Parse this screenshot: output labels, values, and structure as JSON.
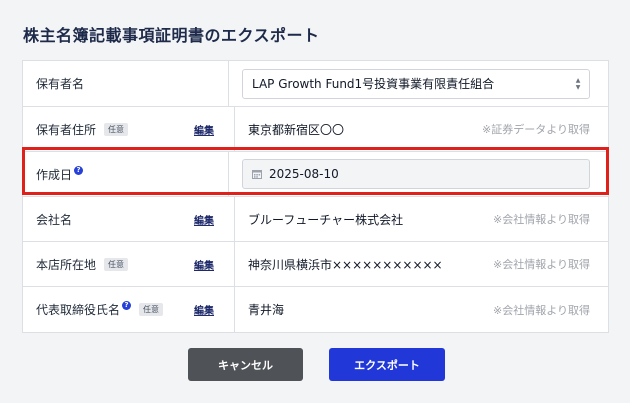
{
  "page": {
    "title": "株主名簿記載事項証明書のエクスポート"
  },
  "form": {
    "holder_name": {
      "label": "保有者名",
      "value": "LAP Growth Fund1号投資事業有限責任組合"
    },
    "holder_address": {
      "label": "保有者住所",
      "badge": "任意",
      "edit": "編集",
      "value": "東京都新宿区〇〇",
      "note": "※証券データより取得"
    },
    "created_date": {
      "label": "作成日",
      "value": "2025-08-10"
    },
    "company_name": {
      "label": "会社名",
      "edit": "編集",
      "value": "ブルーフューチャー株式会社",
      "note": "※会社情報より取得"
    },
    "head_office": {
      "label": "本店所在地",
      "badge": "任意",
      "edit": "編集",
      "value": "神奈川県横浜市×××××××××××",
      "note": "※会社情報より取得"
    },
    "representative": {
      "label": "代表取締役氏名",
      "badge": "任意",
      "edit": "編集",
      "value": "青井海",
      "note": "※会社情報より取得"
    }
  },
  "buttons": {
    "cancel": "キャンセル",
    "export": "エクスポート"
  },
  "icons": {
    "help": "?"
  },
  "colors": {
    "primary": "#2137d8",
    "cancel": "#4f5257",
    "highlight": "#e0201a"
  }
}
